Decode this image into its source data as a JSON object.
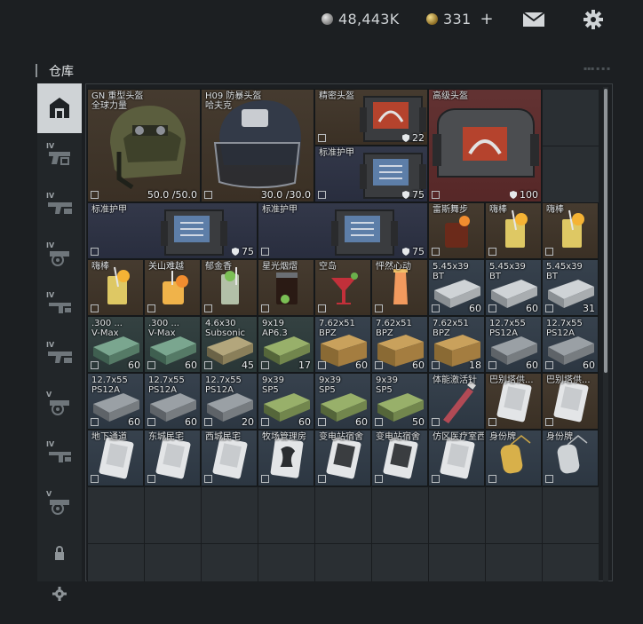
{
  "currency": {
    "roubles": "48,443K",
    "coins": "331",
    "add": "+",
    "coin_colors": {
      "silver": "#bdbdbd",
      "gold": "#c9a447"
    }
  },
  "header": {
    "title": "仓库",
    "mail_icon": "mail-icon",
    "settings_icon": "gear-icon"
  },
  "sidebar": {
    "tabs": [
      {
        "label": "",
        "icon": "warehouse-icon",
        "active": true
      },
      {
        "label": "IV",
        "icon": "pistol-icon",
        "active": false
      },
      {
        "label": "IV",
        "icon": "rifle-icon",
        "active": false
      },
      {
        "label": "IV",
        "icon": "scope-icon",
        "active": false
      },
      {
        "label": "IV",
        "icon": "smg-icon",
        "active": false
      },
      {
        "label": "IV",
        "icon": "rifle-icon",
        "active": false
      },
      {
        "label": "V",
        "icon": "scope-icon",
        "active": false
      },
      {
        "label": "IV",
        "icon": "smg-icon",
        "active": false
      },
      {
        "label": "V",
        "icon": "scope-icon",
        "active": false
      },
      {
        "label": "",
        "icon": "lock-icon",
        "active": false
      },
      {
        "label": "",
        "icon": "gear-icon",
        "active": false
      }
    ]
  },
  "inventory": {
    "items": [
      {
        "name": "GN 重型头盔\n全球力量",
        "count": "50.0 /50.0",
        "art": "helmet-olive",
        "bg": "brown"
      },
      {
        "name": "H09 防暴头盔\n哈夫克",
        "count": "30.0 /30.0",
        "art": "helmet-visor",
        "bg": "brown"
      },
      {
        "name": "精密头盔",
        "count": "22",
        "art": "bag-red",
        "bg": "brown",
        "shield": true
      },
      {
        "name": "标准护甲",
        "count": "75",
        "art": "bag-blue",
        "bg": "navy",
        "shield": true
      },
      {
        "name": "高级头盔",
        "count": "100",
        "art": "bag-red-big",
        "bg": "red",
        "shield": true
      },
      {
        "name": "标准护甲",
        "count": "75",
        "art": "bag-blue",
        "bg": "navy",
        "shield": true
      },
      {
        "name": "标准护甲",
        "count": "75",
        "art": "bag-blue",
        "bg": "navy",
        "shield": true
      },
      {
        "name": "雷斯舞步",
        "count": "",
        "art": "drink-dark",
        "bg": "brown"
      },
      {
        "name": "嗨棒",
        "count": "",
        "art": "drink-lemon",
        "bg": "brown"
      },
      {
        "name": "嗨棒",
        "count": "",
        "art": "drink-lemon",
        "bg": "brown"
      },
      {
        "name": "嗨棒",
        "count": "",
        "art": "drink-lemon",
        "bg": "brown"
      },
      {
        "name": "关山难越",
        "count": "",
        "art": "drink-orange",
        "bg": "brown"
      },
      {
        "name": "郁金香",
        "count": "",
        "art": "drink-mint",
        "bg": "brown"
      },
      {
        "name": "星光烟熠",
        "count": "",
        "art": "drink-cola",
        "bg": "brown"
      },
      {
        "name": "空岛",
        "count": "",
        "art": "drink-red",
        "bg": "brown"
      },
      {
        "name": "怦然心动",
        "count": "",
        "art": "drink-pink",
        "bg": "brown"
      },
      {
        "name": "5.45x39\nBT",
        "count": "60",
        "art": "ammo-white",
        "bg": "steel"
      },
      {
        "name": "5.45x39\nBT",
        "count": "60",
        "art": "ammo-white",
        "bg": "steel"
      },
      {
        "name": "5.45x39\nBT",
        "count": "31",
        "art": "ammo-white",
        "bg": "steel"
      },
      {
        "name": ".300 ...\nV-Max",
        "count": "60",
        "art": "ammo-teal",
        "bg": "teal"
      },
      {
        "name": ".300 ...\nV-Max",
        "count": "60",
        "art": "ammo-teal",
        "bg": "teal"
      },
      {
        "name": "4.6x30\nSubsonic",
        "count": "45",
        "art": "ammo-olive",
        "bg": "teal"
      },
      {
        "name": "9x19\nAP6.3",
        "count": "17",
        "art": "ammo-green",
        "bg": "teal"
      },
      {
        "name": "7.62x51\nBPZ",
        "count": "60",
        "art": "ammo-crate",
        "bg": "steel"
      },
      {
        "name": "7.62x51\nBPZ",
        "count": "60",
        "art": "ammo-crate",
        "bg": "steel"
      },
      {
        "name": "7.62x51\nBPZ",
        "count": "18",
        "art": "ammo-crate",
        "bg": "steel"
      },
      {
        "name": "12.7x55\nPS12A",
        "count": "60",
        "art": "ammo-grey",
        "bg": "steel"
      },
      {
        "name": "12.7x55\nPS12A",
        "count": "60",
        "art": "ammo-grey",
        "bg": "steel"
      },
      {
        "name": "12.7x55\nPS12A",
        "count": "60",
        "art": "ammo-grey",
        "bg": "steel"
      },
      {
        "name": "12.7x55\nPS12A",
        "count": "60",
        "art": "ammo-grey",
        "bg": "steel"
      },
      {
        "name": "12.7x55\nPS12A",
        "count": "20",
        "art": "ammo-grey",
        "bg": "steel"
      },
      {
        "name": "9x39\nSP5",
        "count": "60",
        "art": "ammo-green",
        "bg": "steel"
      },
      {
        "name": "9x39\nSP5",
        "count": "60",
        "art": "ammo-green",
        "bg": "steel"
      },
      {
        "name": "9x39\nSP5",
        "count": "50",
        "art": "ammo-green",
        "bg": "steel"
      },
      {
        "name": "体能激活针",
        "count": "",
        "art": "injector",
        "bg": "steel"
      },
      {
        "name": "巴别塔供...",
        "count": "",
        "art": "keycard",
        "bg": "brown"
      },
      {
        "name": "巴别塔供...",
        "count": "",
        "art": "keycard",
        "bg": "brown"
      },
      {
        "name": "地下通道",
        "count": "",
        "art": "keycard",
        "bg": "steel"
      },
      {
        "name": "东城民宅",
        "count": "",
        "art": "keycard",
        "bg": "steel"
      },
      {
        "name": "西城民宅",
        "count": "",
        "art": "keycard",
        "bg": "steel"
      },
      {
        "name": "牧场管理房",
        "count": "",
        "art": "keycard-black",
        "bg": "steel"
      },
      {
        "name": "变电站宿舍",
        "count": "",
        "art": "keycard-dark",
        "bg": "steel"
      },
      {
        "name": "变电站宿舍",
        "count": "",
        "art": "keycard-dark",
        "bg": "steel"
      },
      {
        "name": "仿区医疗室西",
        "count": "",
        "art": "keycard",
        "bg": "steel"
      },
      {
        "name": "身份牌",
        "count": "",
        "art": "dogtag-gold",
        "bg": "steel"
      },
      {
        "name": "身份牌",
        "count": "",
        "art": "dogtag-silver",
        "bg": "steel"
      }
    ]
  }
}
